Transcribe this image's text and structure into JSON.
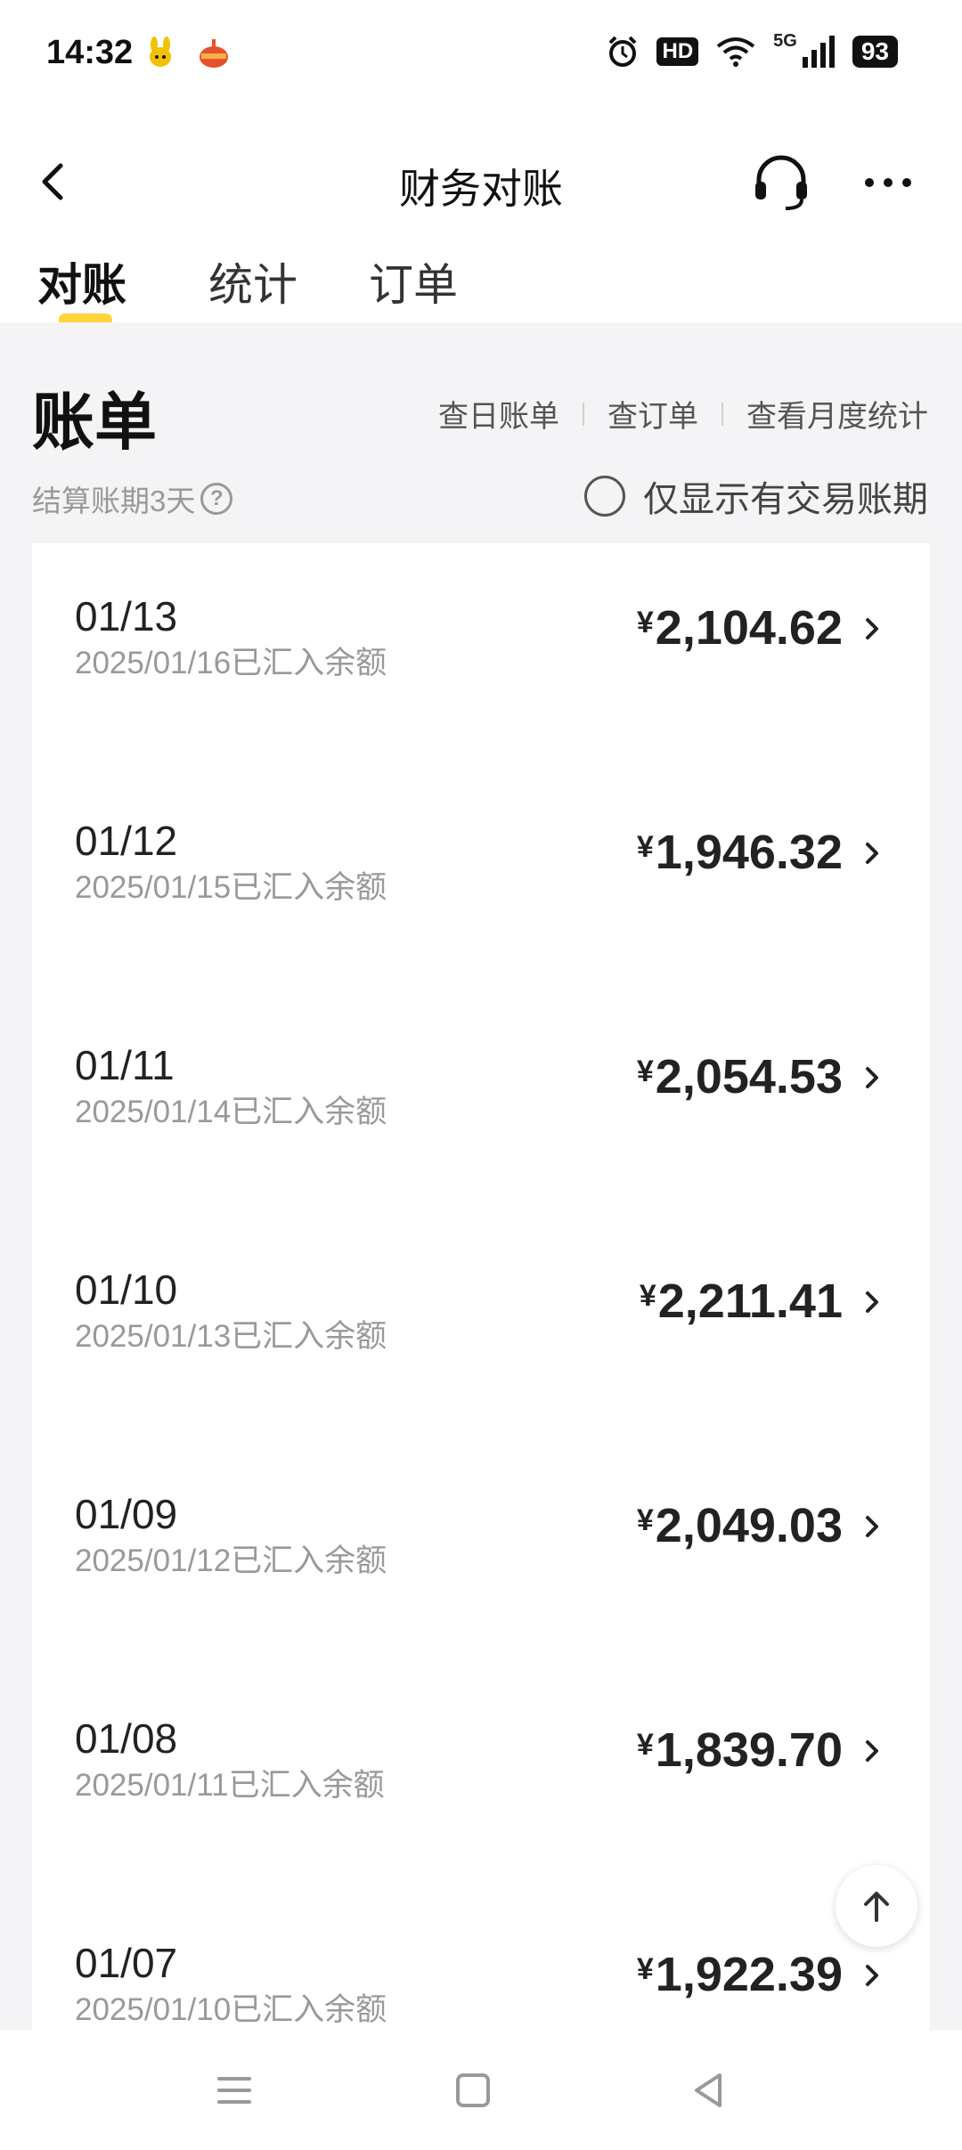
{
  "status_bar": {
    "time": "14:32",
    "battery": "93",
    "network": "5G",
    "hd": "HD",
    "icons": [
      "app-notification-icon",
      "app-notification-icon-2",
      "alarm-icon",
      "hd-icon",
      "wifi-icon",
      "signal-icon",
      "battery-icon"
    ]
  },
  "nav": {
    "title": "财务对账"
  },
  "tabs": [
    {
      "label": "对账",
      "active": true
    },
    {
      "label": "统计",
      "active": false
    },
    {
      "label": "订单",
      "active": false
    }
  ],
  "bill": {
    "title": "账单",
    "links": [
      "查日账单",
      "查订单",
      "查看月度统计"
    ],
    "cycle": "结算账期3天",
    "help": "?",
    "filter_label": "仅显示有交易账期"
  },
  "rows": [
    {
      "date": "01/13",
      "sub": "2025/01/16已汇入余额",
      "currency": "¥",
      "amount": "2,104.62"
    },
    {
      "date": "01/12",
      "sub": "2025/01/15已汇入余额",
      "currency": "¥",
      "amount": "1,946.32"
    },
    {
      "date": "01/11",
      "sub": "2025/01/14已汇入余额",
      "currency": "¥",
      "amount": "2,054.53"
    },
    {
      "date": "01/10",
      "sub": "2025/01/13已汇入余额",
      "currency": "¥",
      "amount": "2,211.41"
    },
    {
      "date": "01/09",
      "sub": "2025/01/12已汇入余额",
      "currency": "¥",
      "amount": "2,049.03"
    },
    {
      "date": "01/08",
      "sub": "2025/01/11已汇入余额",
      "currency": "¥",
      "amount": "1,839.70"
    },
    {
      "date": "01/07",
      "sub": "2025/01/10已汇入余额",
      "currency": "¥",
      "amount": "1,922.39"
    }
  ],
  "colors": {
    "accent": "#ffd33a",
    "background": "#f4f4f6",
    "text_primary": "#222222",
    "text_secondary": "#999999"
  }
}
